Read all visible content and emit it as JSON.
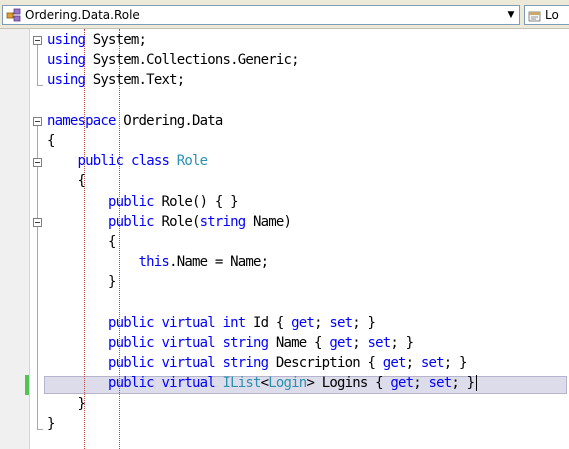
{
  "navigation": {
    "type_dropdown": {
      "value": "Ordering.Data.Role",
      "icon": "class-icon"
    },
    "member_dropdown": {
      "value": "Lo",
      "icon": "property-icon"
    }
  },
  "colors": {
    "keyword": "#0000ff",
    "type": "#2b91af",
    "text": "#000000",
    "guide": "#c0453c",
    "current_line": "#dcdceb",
    "change_marker": "#54c354"
  },
  "code": {
    "lines": [
      {
        "tokens": [
          {
            "t": "using",
            "k": "kw"
          },
          {
            "t": " System;"
          }
        ]
      },
      {
        "tokens": [
          {
            "t": "using",
            "k": "kw"
          },
          {
            "t": " System.Collections.Generic;"
          }
        ]
      },
      {
        "tokens": [
          {
            "t": "using",
            "k": "kw"
          },
          {
            "t": " System.Text;"
          }
        ]
      },
      {
        "tokens": []
      },
      {
        "tokens": [
          {
            "t": "namespace",
            "k": "kw"
          },
          {
            "t": " Ordering.Data"
          }
        ]
      },
      {
        "tokens": [
          {
            "t": "{"
          }
        ]
      },
      {
        "tokens": [
          {
            "t": "    "
          },
          {
            "t": "public",
            "k": "kw"
          },
          {
            "t": " "
          },
          {
            "t": "class",
            "k": "kw"
          },
          {
            "t": " "
          },
          {
            "t": "Role",
            "k": "ty"
          }
        ]
      },
      {
        "tokens": [
          {
            "t": "    {"
          }
        ]
      },
      {
        "tokens": [
          {
            "t": "        "
          },
          {
            "t": "public",
            "k": "kw"
          },
          {
            "t": " Role() { }"
          }
        ]
      },
      {
        "tokens": [
          {
            "t": "        "
          },
          {
            "t": "public",
            "k": "kw"
          },
          {
            "t": " Role("
          },
          {
            "t": "string",
            "k": "kw"
          },
          {
            "t": " Name)"
          }
        ]
      },
      {
        "tokens": [
          {
            "t": "        {"
          }
        ]
      },
      {
        "tokens": [
          {
            "t": "            "
          },
          {
            "t": "this",
            "k": "kw"
          },
          {
            "t": ".Name = Name;"
          }
        ]
      },
      {
        "tokens": [
          {
            "t": "        }"
          }
        ]
      },
      {
        "tokens": []
      },
      {
        "tokens": [
          {
            "t": "        "
          },
          {
            "t": "public",
            "k": "kw"
          },
          {
            "t": " "
          },
          {
            "t": "virtual",
            "k": "kw"
          },
          {
            "t": " "
          },
          {
            "t": "int",
            "k": "kw"
          },
          {
            "t": " Id { "
          },
          {
            "t": "get",
            "k": "kw"
          },
          {
            "t": "; "
          },
          {
            "t": "set",
            "k": "kw"
          },
          {
            "t": "; }"
          }
        ]
      },
      {
        "tokens": [
          {
            "t": "        "
          },
          {
            "t": "public",
            "k": "kw"
          },
          {
            "t": " "
          },
          {
            "t": "virtual",
            "k": "kw"
          },
          {
            "t": " "
          },
          {
            "t": "string",
            "k": "kw"
          },
          {
            "t": " Name { "
          },
          {
            "t": "get",
            "k": "kw"
          },
          {
            "t": "; "
          },
          {
            "t": "set",
            "k": "kw"
          },
          {
            "t": "; }"
          }
        ]
      },
      {
        "tokens": [
          {
            "t": "        "
          },
          {
            "t": "public",
            "k": "kw"
          },
          {
            "t": " "
          },
          {
            "t": "virtual",
            "k": "kw"
          },
          {
            "t": " "
          },
          {
            "t": "string",
            "k": "kw"
          },
          {
            "t": " Description { "
          },
          {
            "t": "get",
            "k": "kw"
          },
          {
            "t": "; "
          },
          {
            "t": "set",
            "k": "kw"
          },
          {
            "t": "; }"
          }
        ]
      },
      {
        "tokens": [
          {
            "t": "        "
          },
          {
            "t": "public",
            "k": "kw"
          },
          {
            "t": " "
          },
          {
            "t": "virtual",
            "k": "kw"
          },
          {
            "t": " "
          },
          {
            "t": "IList",
            "k": "ty"
          },
          {
            "t": "<"
          },
          {
            "t": "Login",
            "k": "ty"
          },
          {
            "t": "> Logins { "
          },
          {
            "t": "get",
            "k": "kw"
          },
          {
            "t": "; "
          },
          {
            "t": "set",
            "k": "kw"
          },
          {
            "t": "; }"
          }
        ],
        "current": true
      },
      {
        "tokens": [
          {
            "t": "    }"
          }
        ]
      },
      {
        "tokens": [
          {
            "t": "}"
          }
        ]
      }
    ]
  }
}
